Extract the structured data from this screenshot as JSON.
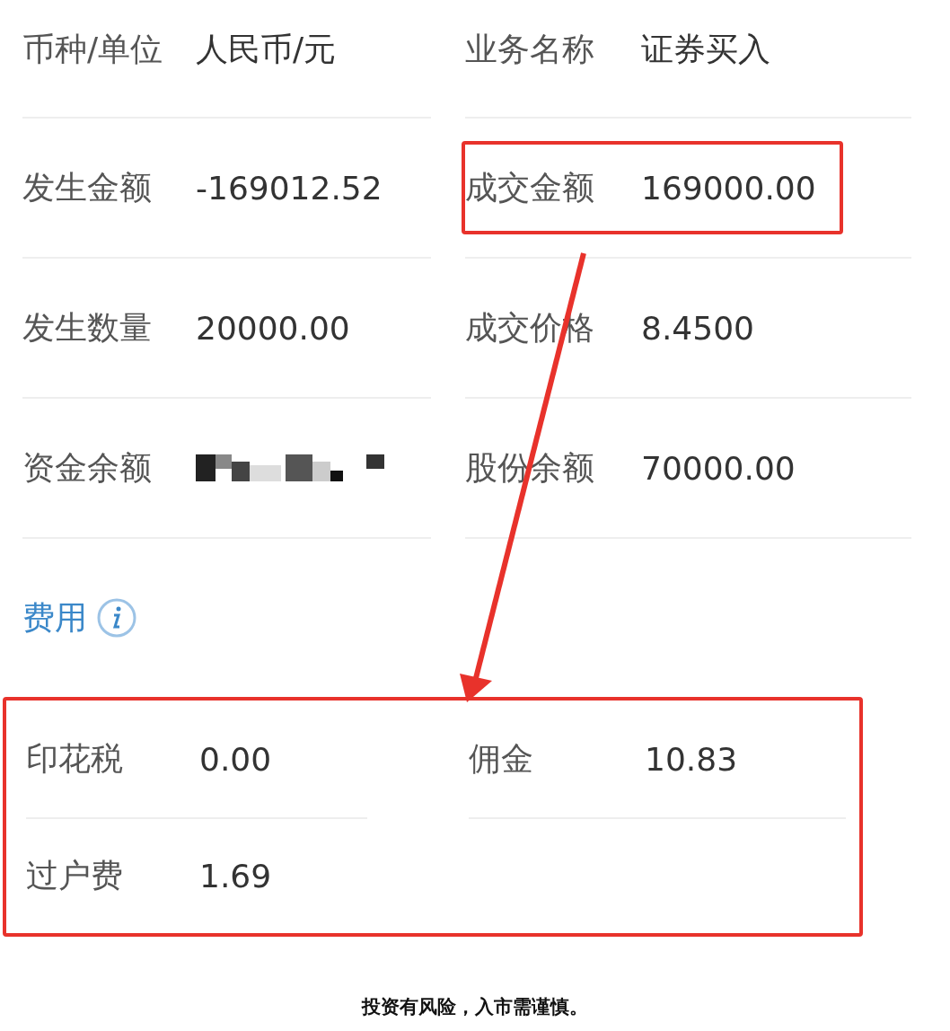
{
  "rows": [
    {
      "cells": [
        {
          "label": "币种/单位",
          "value": "人民币/元",
          "highlighted": false
        },
        {
          "label": "业务名称",
          "value": "证券买入",
          "highlighted": false
        }
      ]
    },
    {
      "cells": [
        {
          "label": "发生金额",
          "value": "-169012.52",
          "highlighted": false
        },
        {
          "label": "成交金额",
          "value": "169000.00",
          "highlighted": true
        }
      ]
    },
    {
      "cells": [
        {
          "label": "发生数量",
          "value": "20000.00",
          "highlighted": false
        },
        {
          "label": "成交价格",
          "value": "8.4500",
          "highlighted": false
        }
      ]
    },
    {
      "cells": [
        {
          "label": "资金余额",
          "redacted": true,
          "highlighted": false
        },
        {
          "label": "股份余额",
          "value": "70000.00",
          "highlighted": false
        }
      ]
    }
  ],
  "fees": {
    "title": "费用",
    "highlighted": true,
    "rows": [
      [
        {
          "label": "印花税",
          "value": "0.00"
        },
        {
          "label": "佣金",
          "value": "10.83"
        }
      ],
      [
        {
          "label": "过户费",
          "value": "1.69"
        }
      ]
    ]
  },
  "annotation": {
    "kind": "arrow"
  },
  "caption": "投资有风险，入市需谨慎。"
}
